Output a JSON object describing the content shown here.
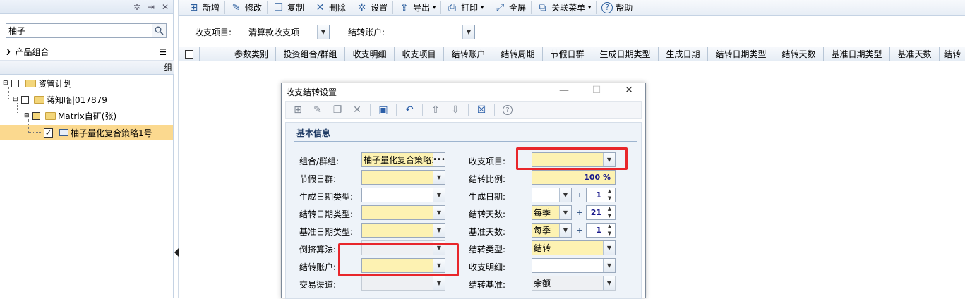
{
  "left_panel": {
    "header_icons": [
      "gear-icon",
      "pin-icon",
      "close-icon"
    ],
    "search": {
      "value": "柚子"
    },
    "group_label": "产品组合",
    "subheader": "组",
    "tree": [
      {
        "label": "资管计划"
      },
      {
        "label": "蒋知临|017879"
      },
      {
        "label": "Matrix自研(张)"
      },
      {
        "label": "柚子量化复合策略1号",
        "checked": true,
        "selected": true
      }
    ]
  },
  "toolbar": {
    "items": [
      {
        "label": "新增",
        "icon": "add-icon"
      },
      {
        "label": "修改",
        "icon": "edit-icon"
      },
      {
        "label": "复制",
        "icon": "copy-icon"
      },
      {
        "label": "删除",
        "icon": "delete-icon"
      },
      {
        "label": "设置",
        "icon": "gear-icon"
      },
      {
        "label": "导出",
        "icon": "export-icon"
      },
      {
        "label": "打印",
        "icon": "print-icon"
      },
      {
        "label": "全屏",
        "icon": "fullscreen-icon"
      },
      {
        "label": "关联菜单",
        "icon": "link-menu-icon"
      },
      {
        "label": "帮助",
        "icon": "help-icon"
      }
    ]
  },
  "filter": {
    "item_label": "收支项目:",
    "item_value": "清算款收支项",
    "account_label": "结转账户:",
    "account_value": ""
  },
  "grid": {
    "columns": [
      "参数类别",
      "投资组合/群组",
      "收支明细",
      "收支项目",
      "结转账户",
      "结转周期",
      "节假日群",
      "生成日期类型",
      "生成日期",
      "结转日期类型",
      "结转天数",
      "基准日期类型",
      "基准天数",
      "结转"
    ]
  },
  "dialog": {
    "title": "收支结转设置",
    "section_title": "基本信息",
    "fields": {
      "group": {
        "label": "组合/群组:",
        "value": "柚子量化复合策略1号"
      },
      "holiday": {
        "label": "节假日群:",
        "value": ""
      },
      "gen_date_type": {
        "label": "生成日期类型:",
        "value": ""
      },
      "carry_date_type": {
        "label": "结转日期类型:",
        "value": ""
      },
      "base_date_type": {
        "label": "基准日期类型:",
        "value": ""
      },
      "reverse_algo": {
        "label": "倒挤算法:",
        "value": ""
      },
      "carry_account": {
        "label": "结转账户:",
        "value": ""
      },
      "channel": {
        "label": "交易渠道:",
        "value": ""
      },
      "income_item": {
        "label": "收支项目:",
        "value": ""
      },
      "carry_ratio": {
        "label": "结转比例:",
        "value": "100 %"
      },
      "gen_date": {
        "label": "生成日期:",
        "value": "",
        "plus": "+",
        "num": "1"
      },
      "carry_days": {
        "label": "结转天数:",
        "value": "每季",
        "plus": "+",
        "num": "21"
      },
      "base_days": {
        "label": "基准天数:",
        "value": "每季",
        "plus": "+",
        "num": "1"
      },
      "carry_type": {
        "label": "结转类型:",
        "value": "结转"
      },
      "income_detail": {
        "label": "收支明细:",
        "value": ""
      },
      "carry_basis": {
        "label": "结转基准:",
        "value": "余额"
      }
    }
  },
  "colors": {
    "highlight": "#e8262b",
    "required_field": "#fdf2b2",
    "selected_row": "#fbd98f"
  }
}
